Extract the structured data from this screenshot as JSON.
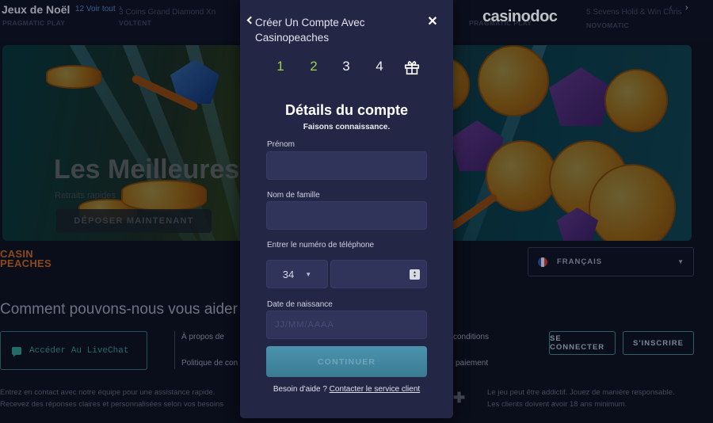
{
  "background": {
    "category_title": "Jeux de Noël",
    "see_all": "12 Voir tout",
    "games": [
      {
        "title": "3 Coins Grand Diamond Xn",
        "provider": "PRAGMATIC PLAY"
      },
      {
        "title": "",
        "provider": "VOLTENT"
      },
      {
        "title": "",
        "provider": "PRAGMATIC PLAY"
      },
      {
        "title": "5 Sevens Hold & Win Chris",
        "provider": "NOVOMATIC"
      }
    ],
    "brand": "casinodoc",
    "banner": {
      "title": "Les Meilleures",
      "subtitle": "Retraits rapides",
      "cta": "DÉPOSER MAINTENANT"
    },
    "casino_logo": [
      "CASIN",
      "PEACHES"
    ],
    "language": "FRANÇAIS",
    "help_title": "Comment pouvons-nous vous aider",
    "livechat": "Accéder Au LiveChat",
    "links": [
      "À propos de",
      "Politique de con",
      "conditions",
      "paiement"
    ],
    "login": "SE CONNECTER",
    "signup": "S'INSCRIRE",
    "contact_text": [
      "Entrez en contact avec notre équipe pour une assistance rapide.",
      "Recevez des réponses claires et personnalisées selon vos besoins"
    ],
    "responsible_text": [
      "Le jeu peut être addictif. Jouez de manière responsable.",
      "Les clients doivent avoir 18 ans minimum."
    ]
  },
  "modal": {
    "header": "Créer Un Compte Avec Casinopeaches",
    "steps": [
      {
        "label": "1",
        "state": "done"
      },
      {
        "label": "2",
        "state": "done"
      },
      {
        "label": "3",
        "state": "todo"
      },
      {
        "label": "4",
        "state": "todo"
      }
    ],
    "title": "Détails du compte",
    "subtitle": "Faisons connaissance.",
    "fields": {
      "first_name_label": "Prénom",
      "last_name_label": "Nom de famille",
      "phone_label": "Entrer le numéro de téléphone",
      "country_code": "34",
      "birth_label": "Date de naissance",
      "birth_placeholder": "JJ/MM/AAAA"
    },
    "continue": "CONTINUER",
    "help_prefix": "Besoin d'aide ?",
    "help_link": "Contacter le service client"
  },
  "colors": {
    "modal_bg": "#242645",
    "step_done": "#9ad24a",
    "accent_button": "#4c93ad"
  }
}
